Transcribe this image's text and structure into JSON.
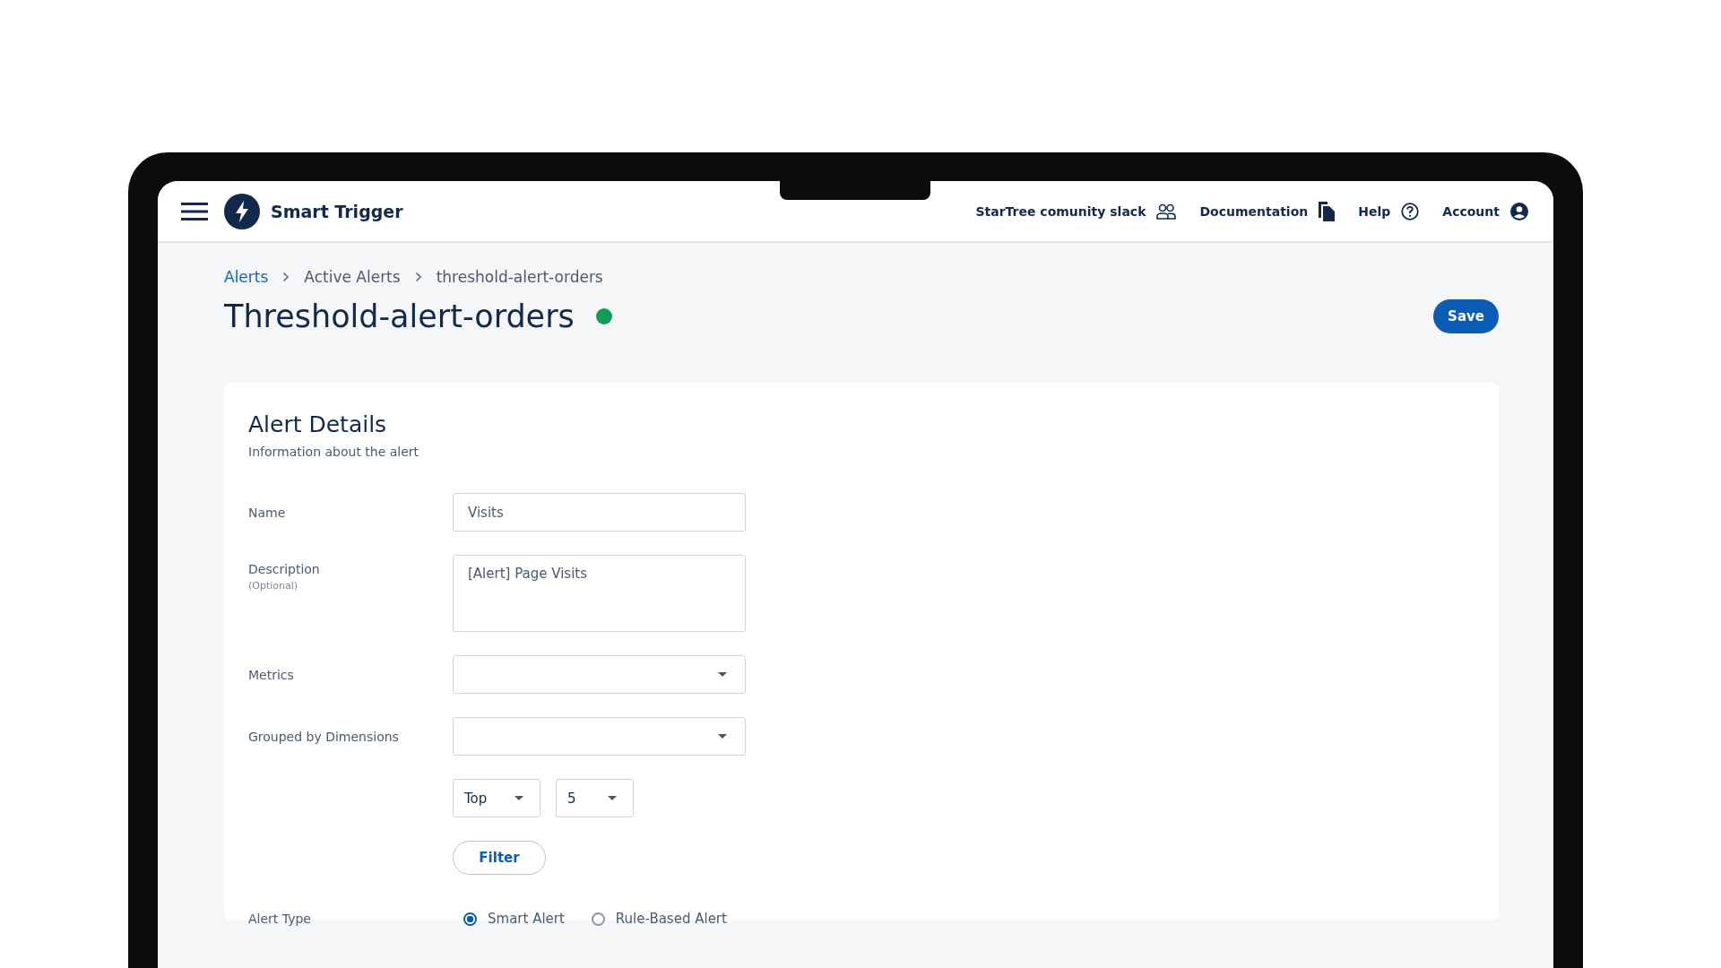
{
  "app": {
    "title": "Smart Trigger",
    "links": [
      {
        "label": "StarTree comunity slack",
        "kind": "people"
      },
      {
        "label": "Documentation",
        "kind": "docs"
      },
      {
        "label": "Help",
        "kind": "help"
      },
      {
        "label": "Account",
        "kind": "account"
      }
    ]
  },
  "breadcrumbs": [
    {
      "label": "Alerts",
      "kind": "link"
    },
    {
      "label": "Active Alerts",
      "kind": "text"
    },
    {
      "label": "threshold-alert-orders",
      "kind": "text"
    }
  ],
  "page": {
    "title": "Threshold-alert-orders",
    "color": "#0f9d58",
    "save": "Save"
  },
  "card": {
    "title": "Alert Details",
    "subtitle": "Information about the alert",
    "fields": [
      {
        "kind": "input",
        "label": "Name",
        "value": "Visits"
      },
      {
        "kind": "textarea",
        "label": "Description",
        "hint": "(Optional)",
        "value": "[Alert] Page Visits"
      },
      {
        "kind": "select",
        "label": "Metrics"
      },
      {
        "kind": "select",
        "label": "Grouped by Dimensions"
      }
    ],
    "top_select": {
      "value": "Top"
    },
    "count_select": {
      "value": "5"
    },
    "filter": "Filter",
    "alert_type": {
      "label": "Alert Type",
      "options": [
        {
          "label": "Smart Alert",
          "selected": true
        },
        {
          "label": "Rule-Based Alert",
          "selected": false
        }
      ]
    }
  }
}
